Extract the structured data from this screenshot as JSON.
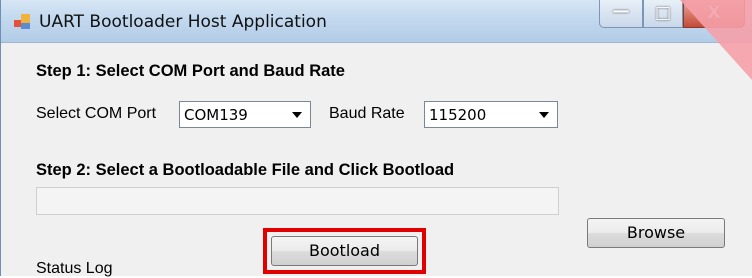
{
  "window": {
    "title": "UART Bootloader Host Application",
    "controls": {
      "minimize": "—",
      "maximize": "□",
      "close": "X"
    }
  },
  "step1": {
    "heading": "Step 1: Select COM Port and Baud Rate",
    "com_port_label": "Select COM Port",
    "com_port_value": "COM139",
    "baud_rate_label": "Baud Rate",
    "baud_rate_value": "115200"
  },
  "step2": {
    "heading": "Step 2: Select a Bootloadable File and Click Bootload",
    "file_path_value": "",
    "browse_label": "Browse"
  },
  "bootload_label": "Bootload",
  "status_log_label": "Status Log",
  "colors": {
    "highlight": "#e00000",
    "titlebar": "#c2d8ee",
    "close_button": "#c44b38"
  }
}
